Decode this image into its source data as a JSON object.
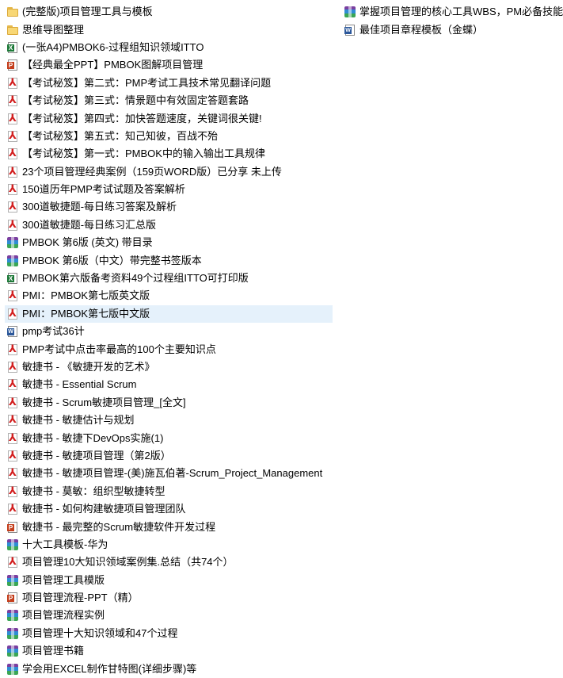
{
  "left_column": [
    {
      "label": "(完整版)项目管理工具与模板",
      "icon": "folder-icon",
      "selected": false
    },
    {
      "label": "思维导图整理",
      "icon": "folder-icon",
      "selected": false
    },
    {
      "label": "(一张A4)PMBOK6-过程组知识领域ITTO",
      "icon": "excel-file-icon",
      "selected": false
    },
    {
      "label": "【经典最全PPT】PMBOK图解项目管理",
      "icon": "powerpoint-file-icon",
      "selected": false
    },
    {
      "label": "【考试秘笈】第二式：PMP考试工具技术常见翻译问题",
      "icon": "pdf-file-icon",
      "selected": false
    },
    {
      "label": "【考试秘笈】第三式：情景题中有效固定答题套路",
      "icon": "pdf-file-icon",
      "selected": false
    },
    {
      "label": "【考试秘笈】第四式：加快答题速度，关键词很关键!",
      "icon": "pdf-file-icon",
      "selected": false
    },
    {
      "label": "【考试秘笈】第五式：知己知彼，百战不殆",
      "icon": "pdf-file-icon",
      "selected": false
    },
    {
      "label": "【考试秘笈】第一式：PMBOK中的输入输出工具规律",
      "icon": "pdf-file-icon",
      "selected": false
    },
    {
      "label": "23个项目管理经典案例（159页WORD版）已分享 未上传",
      "icon": "pdf-file-icon",
      "selected": false
    },
    {
      "label": "150道历年PMP考试试题及答案解析",
      "icon": "pdf-file-icon",
      "selected": false
    },
    {
      "label": "300道敏捷题-每日练习答案及解析",
      "icon": "pdf-file-icon",
      "selected": false
    },
    {
      "label": "300道敏捷题-每日练习汇总版",
      "icon": "pdf-file-icon",
      "selected": false
    },
    {
      "label": "PMBOK 第6版 (英文) 带目录",
      "icon": "archive-file-icon",
      "selected": false
    },
    {
      "label": "PMBOK 第6版（中文）带完整书签版本",
      "icon": "archive-file-icon",
      "selected": false
    },
    {
      "label": "PMBOK第六版备考资料49个过程组ITTO可打印版",
      "icon": "excel-file-icon",
      "selected": false
    },
    {
      "label": "PMI：PMBOK第七版英文版",
      "icon": "pdf-file-icon",
      "selected": false
    },
    {
      "label": "PMI：PMBOK第七版中文版",
      "icon": "pdf-file-icon",
      "selected": true
    },
    {
      "label": "pmp考试36计",
      "icon": "word-file-icon",
      "selected": false
    },
    {
      "label": "PMP考试中点击率最高的100个主要知识点",
      "icon": "pdf-file-icon",
      "selected": false
    },
    {
      "label": "敏捷书 - 《敏捷开发的艺术》",
      "icon": "pdf-file-icon",
      "selected": false
    },
    {
      "label": "敏捷书 - Essential Scrum",
      "icon": "pdf-file-icon",
      "selected": false
    },
    {
      "label": "敏捷书 - Scrum敏捷项目管理_[全文]",
      "icon": "pdf-file-icon",
      "selected": false
    },
    {
      "label": "敏捷书 - 敏捷估计与规划",
      "icon": "pdf-file-icon",
      "selected": false
    },
    {
      "label": "敏捷书 - 敏捷下DevOps实施(1)",
      "icon": "pdf-file-icon",
      "selected": false
    },
    {
      "label": "敏捷书 - 敏捷项目管理（第2版）",
      "icon": "pdf-file-icon",
      "selected": false
    },
    {
      "label": "敏捷书 - 敏捷项目管理-(美)施瓦伯著-Scrum_Project_Management",
      "icon": "pdf-file-icon",
      "selected": false
    },
    {
      "label": "敏捷书 - 莫敏：组织型敏捷转型",
      "icon": "pdf-file-icon",
      "selected": false
    },
    {
      "label": "敏捷书 - 如何构建敏捷项目管理团队",
      "icon": "pdf-file-icon",
      "selected": false
    },
    {
      "label": "敏捷书 - 最完整的Scrum敏捷软件开发过程",
      "icon": "powerpoint-file-icon",
      "selected": false
    },
    {
      "label": "十大工具模板-华为",
      "icon": "archive-file-icon",
      "selected": false
    },
    {
      "label": "项目管理10大知识领域案例集.总结（共74个）",
      "icon": "pdf-file-icon",
      "selected": false
    },
    {
      "label": "项目管理工具模版",
      "icon": "archive-file-icon",
      "selected": false
    },
    {
      "label": "项目管理流程-PPT（精）",
      "icon": "powerpoint-file-icon",
      "selected": false
    },
    {
      "label": "项目管理流程实例",
      "icon": "archive-file-icon",
      "selected": false
    },
    {
      "label": "项目管理十大知识领域和47个过程",
      "icon": "archive-file-icon",
      "selected": false
    },
    {
      "label": "项目管理书籍",
      "icon": "archive-file-icon",
      "selected": false
    },
    {
      "label": "学会用EXCEL制作甘特图(详细步骤)等",
      "icon": "archive-file-icon",
      "selected": false
    }
  ],
  "right_column": [
    {
      "label": "掌握项目管理的核心工具WBS，PM必备技能",
      "icon": "archive-file-icon",
      "selected": false
    },
    {
      "label": "最佳项目章程模板（金蝶）",
      "icon": "word-file-icon",
      "selected": false
    }
  ],
  "colors": {
    "selection": "#e5f1fb",
    "pdf": "#d21f1f",
    "excel": "#1f7a3a",
    "powerpoint": "#c43e1c",
    "word": "#2b579a",
    "folder": "#f8d775"
  }
}
